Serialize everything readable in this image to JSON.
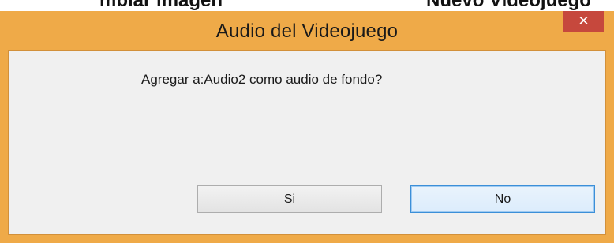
{
  "background_clip": {
    "left_text": "mbiar imagen",
    "right_text": "Nuevo Videojuego"
  },
  "window": {
    "title": "Audio del Videojuego",
    "close_label": "✕",
    "accent_color": "#efaa48",
    "close_color": "#c6483d"
  },
  "dialog": {
    "message": "Agregar a:Audio2 como audio de fondo?",
    "buttons": {
      "yes_label": "Si",
      "no_label": "No"
    }
  }
}
